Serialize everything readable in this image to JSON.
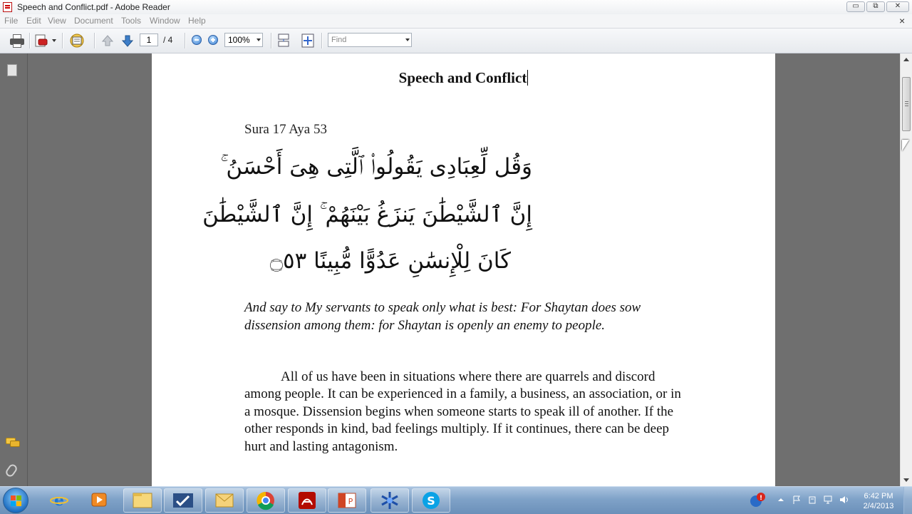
{
  "window": {
    "title": "Speech and Conflict.pdf - Adobe Reader",
    "min_label": "▭",
    "max_label": "⧉",
    "close_label": "✕",
    "doc_close_label": "×"
  },
  "menu": {
    "items": [
      "File",
      "Edit",
      "View",
      "Document",
      "Tools",
      "Window",
      "Help"
    ]
  },
  "toolbar": {
    "page_current": "1",
    "page_total": "/ 4",
    "zoom": "100%",
    "find_placeholder": "Find"
  },
  "document": {
    "title": "Speech and Conflict",
    "sura_ref": "Sura 17 Aya 53",
    "arabic_lines": [
      "وَقُل لِّعِبَادِى يَقُولُوا۟ ٱلَّتِى هِىَ أَحْسَنُ ۚ",
      "إِنَّ ٱلشَّيْطَٰنَ يَنزَغُ بَيْنَهُمْ ۚ إِنَّ ٱلشَّيْطَٰنَ",
      "كَانَ لِلْإِنسَٰنِ عَدُوًّا مُّبِينًا ۝٥٣"
    ],
    "translation": "And say to My servants to speak only what is best: For Shaytan does sow dissension among them: for Shaytan is openly an enemy to people.",
    "paragraph": "All of us have been in situations where there are quarrels and discord among people. It can be experienced in a family, a business, an association, or in a mosque. Dissension begins when someone starts to speak ill of another. If the other responds in kind, bad feelings multiply. If it continues, there can be deep hurt and lasting antagonism."
  },
  "taskbar": {
    "time": "6:42 PM",
    "date": "2/4/2013",
    "buttons": [
      "internet-explorer",
      "media-player",
      "file-explorer",
      "task-app",
      "outlook",
      "chrome",
      "adobe-reader",
      "powerpoint",
      "snowflake-app",
      "skype"
    ]
  },
  "colors": {
    "doc_background": "#6f6f6f",
    "page": "#ffffff",
    "taskbar": "#7fa2c8"
  }
}
